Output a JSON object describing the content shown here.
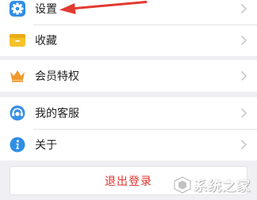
{
  "menu": {
    "settings_label": "设置",
    "favorites_label": "收藏",
    "membership_label": "会员特权",
    "service_label": "我的客服",
    "about_label": "关于"
  },
  "logout_label": "退出登录",
  "watermark_text": "系统之家",
  "colors": {
    "settings_icon": "#2f8ee6",
    "favorites_icon": "#f5c22a",
    "membership_icon": "#f0992c",
    "service_icon": "#3a8fe8",
    "about_icon": "#2f8ee6",
    "logout_text": "#e0332e",
    "annotation_arrow": "#e23a30",
    "background": "#efeff4"
  },
  "icons": {
    "settings": "gear-icon",
    "favorites": "folder-icon",
    "membership": "crown-icon",
    "service": "headset-icon",
    "about": "info-icon",
    "chevron": "chevron-right-icon",
    "annotation": "red-arrow-icon"
  }
}
